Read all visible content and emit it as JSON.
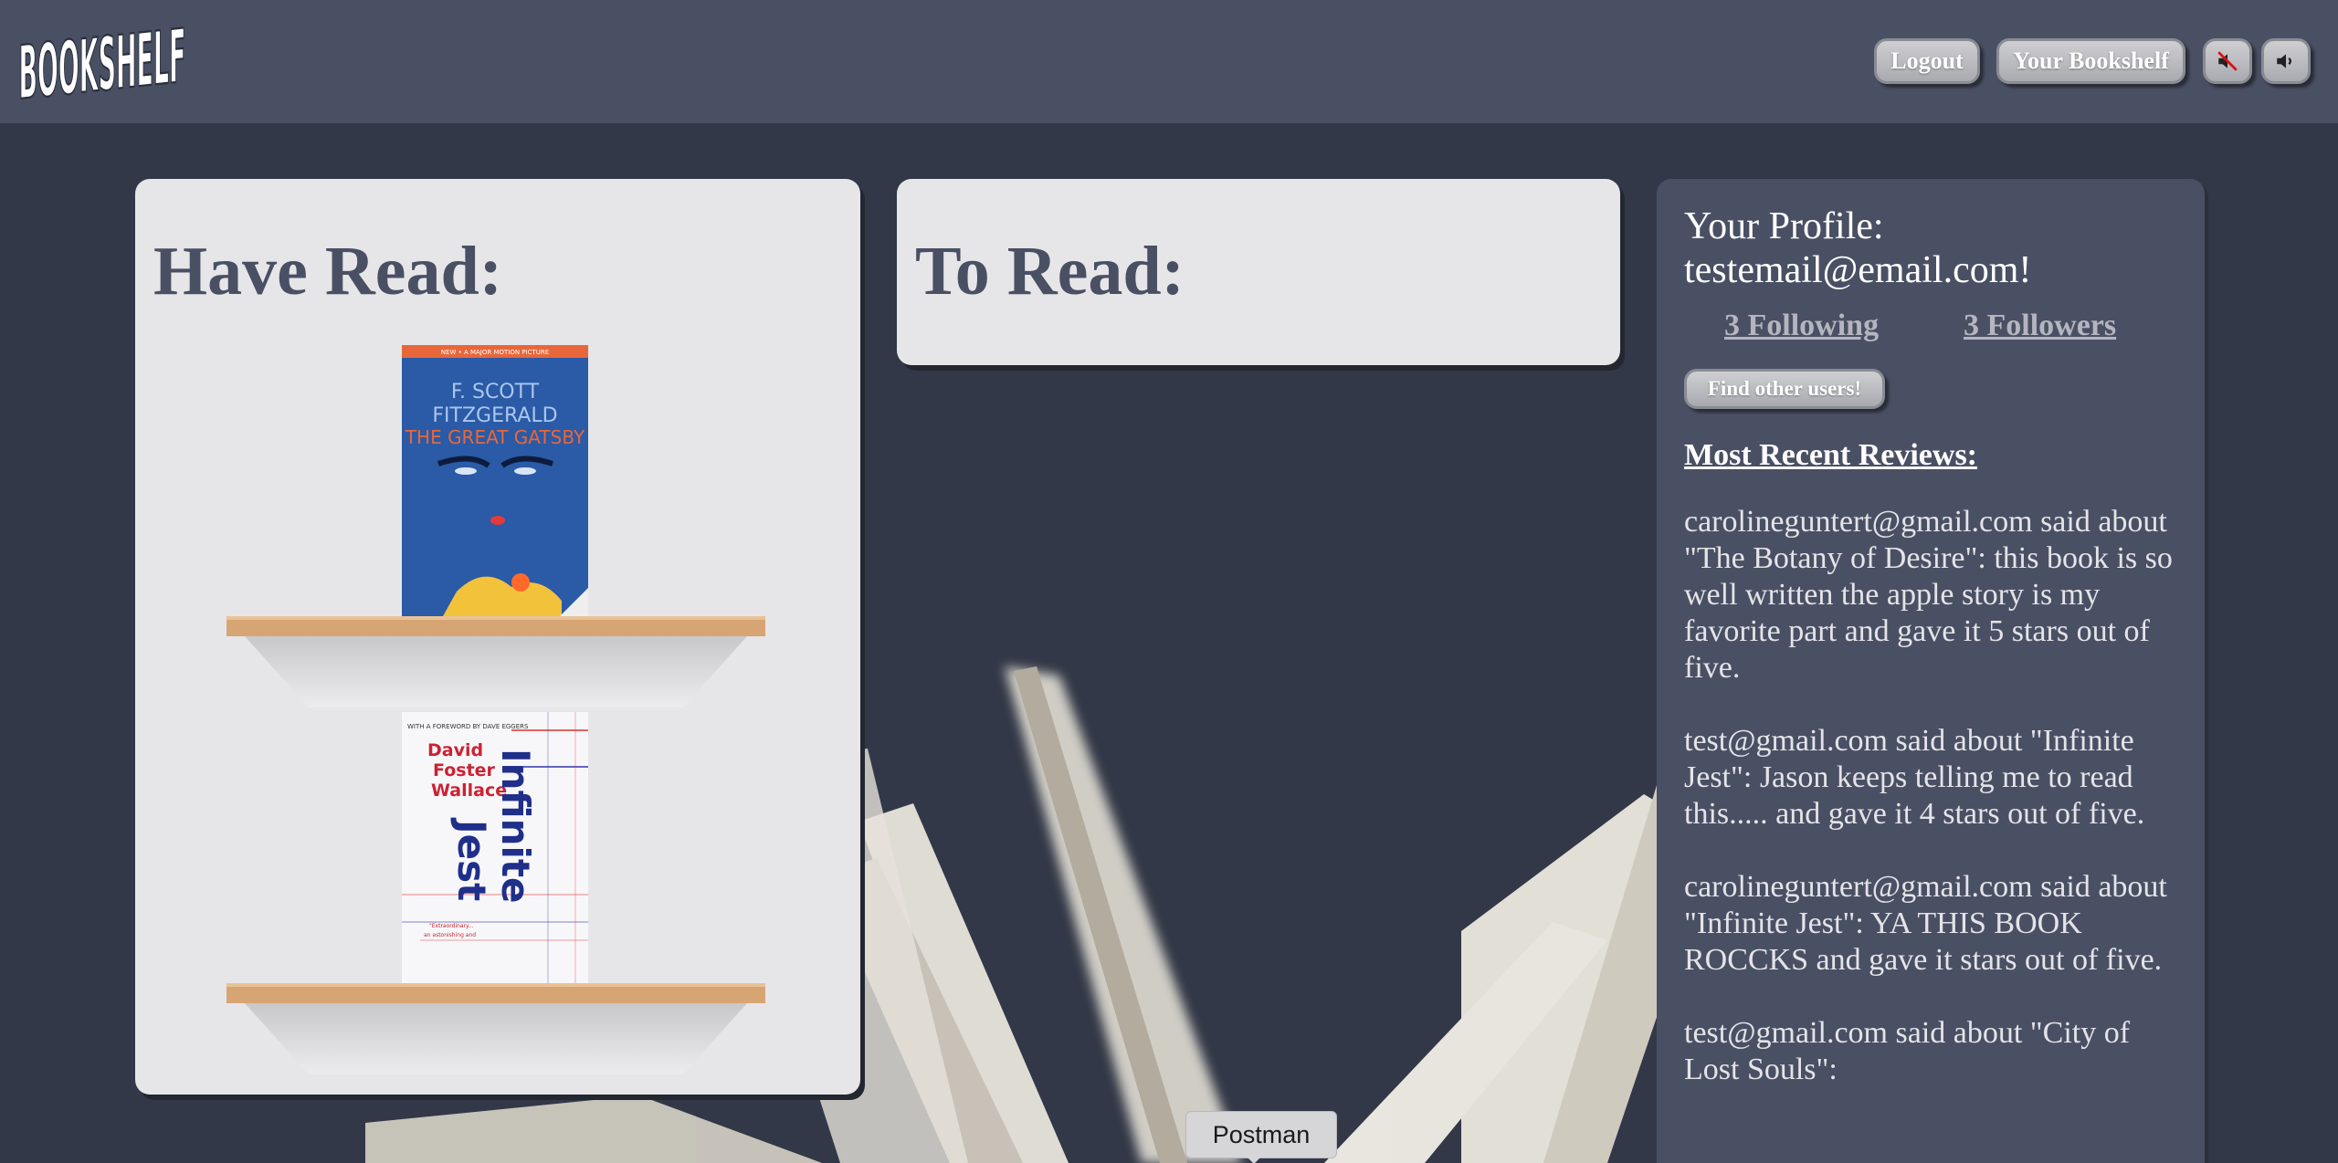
{
  "header": {
    "logo_text": "BOOKSHELF",
    "buttons": {
      "logout": "Logout",
      "your_bookshelf": "Your Bookshelf",
      "mute_icon": "speaker-muted-icon",
      "volume_icon": "speaker-volume-icon"
    }
  },
  "have_read": {
    "title": "Have Read:",
    "books": [
      {
        "cover_author": "F. SCOTT FITZGERALD",
        "cover_title": "THE GREAT GATSBY",
        "cover_banner": "NEW • A MAJOR MOTION PICTURE"
      },
      {
        "cover_foreword": "WITH A FOREWORD BY DAVE EGGERS",
        "cover_author": "David Foster Wallace",
        "cover_title": "Infinite Jest"
      }
    ]
  },
  "to_read": {
    "title": "To Read:"
  },
  "profile": {
    "title": "Your Profile: testemail@email.com!",
    "following": "3 Following",
    "followers": "3 Followers",
    "find_users_button": "Find other users!",
    "reviews_heading": "Most Recent Reviews:",
    "reviews": [
      "carolineguntert@gmail.com said about \"The Botany of Desire\": this book is so well written the apple story is my favorite part and gave it 5 stars out of five.",
      "test@gmail.com said about \"Infinite Jest\": Jason keeps telling me to read this..... and gave it 4 stars out of five.",
      "carolineguntert@gmail.com said about \"Infinite Jest\": YA THIS BOOK ROCCKS and gave it stars out of five.",
      "test@gmail.com said about \"City of Lost Souls\":"
    ]
  },
  "tooltip": {
    "text": "Postman"
  },
  "colors": {
    "page_bg": "#323847",
    "header_bg": "#4a5064",
    "panel_bg": "#e6e6e8",
    "profile_bg": "#4a5064",
    "title_text": "#4a5064"
  }
}
